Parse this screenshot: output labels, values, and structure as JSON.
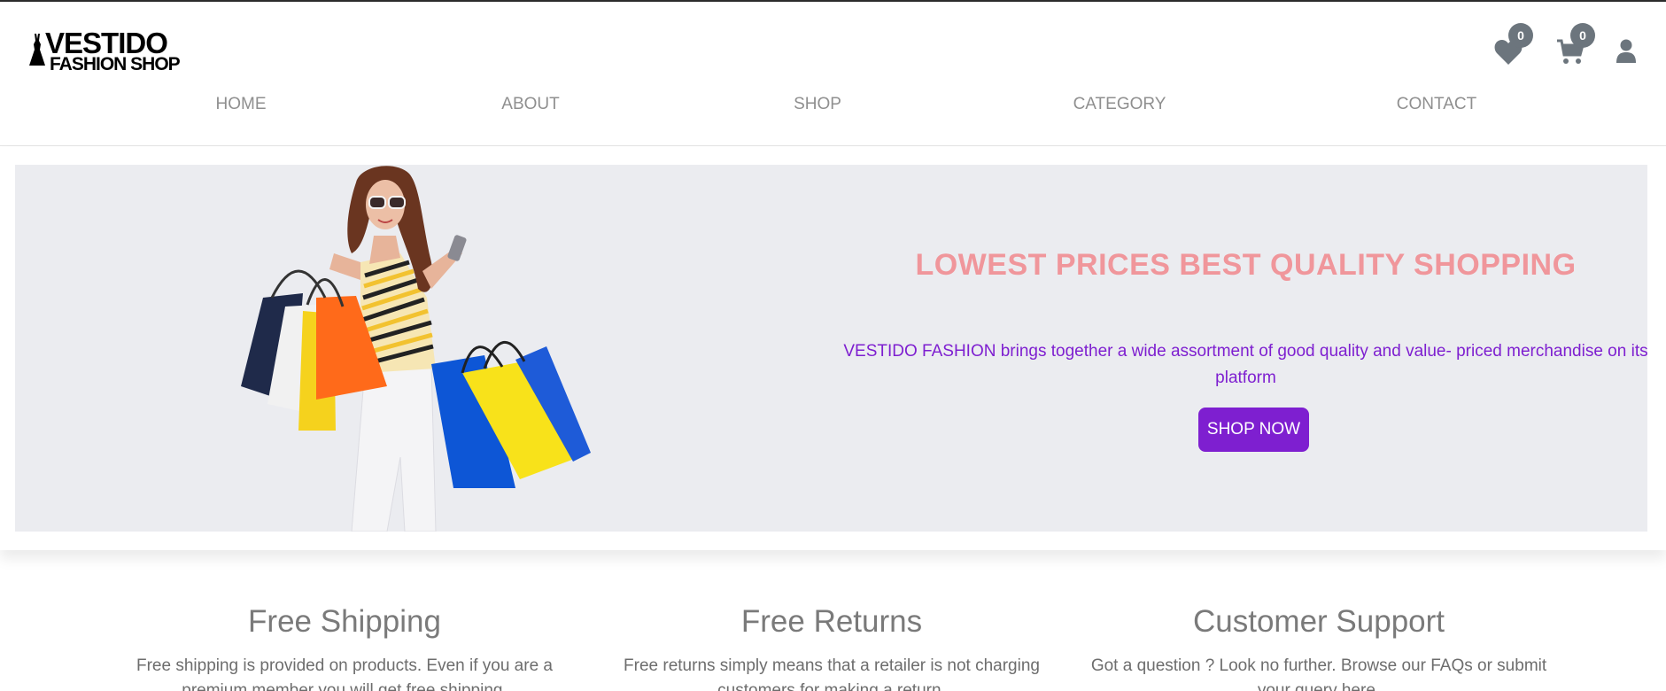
{
  "brand": {
    "line1": "VESTIDO",
    "line2": "FASHION SHOP"
  },
  "header": {
    "wishlist_count": "0",
    "cart_count": "0",
    "icon_color": "#6c757d"
  },
  "nav": {
    "items": [
      {
        "label": "HOME"
      },
      {
        "label": "ABOUT"
      },
      {
        "label": "SHOP"
      },
      {
        "label": "CATEGORY"
      },
      {
        "label": "CONTACT"
      }
    ]
  },
  "hero": {
    "title": "LOWEST PRICES BEST QUALITY SHOPPING",
    "description": "VESTIDO FASHION brings together a wide assortment of good quality and value- priced merchandise on its platform",
    "button_label": "SHOP NOW",
    "title_color": "#f0969b",
    "accent_color": "#7e1fd0",
    "background_color": "#ebecf0"
  },
  "features": [
    {
      "title": "Free Shipping",
      "text": "Free shipping is provided on products. Even if you are a premium member you will get free shipping."
    },
    {
      "title": "Free Returns",
      "text": "Free returns simply means that a retailer is not charging customers for making a return."
    },
    {
      "title": "Customer Support",
      "text": "Got a question ? Look no further. Browse our FAQs or submit your query here."
    }
  ]
}
